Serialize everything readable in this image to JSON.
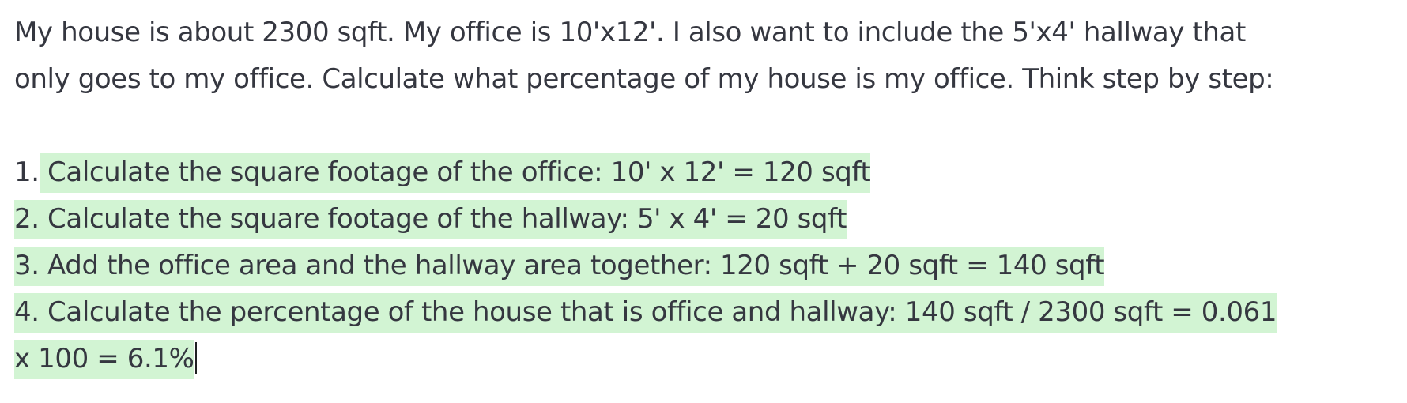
{
  "prompt": {
    "line1": "My house is about 2300 sqft. My office is 10'x12'. I also want to include the 5'x4' hallway that",
    "line2": "only goes to my office. Calculate what percentage of my house is my office. Think step by step:"
  },
  "completion": {
    "step1_number": "1.",
    "step1_text": " Calculate the square footage of the office: 10' x 12' = 120 sqft",
    "step2_text": "2. Calculate the square footage of the hallway: 5' x 4' = 20 sqft",
    "step3_text": "3. Add the office area and the hallway area together: 120 sqft + 20 sqft = 140 sqft",
    "step4_line1": "4. Calculate the percentage of the house that is office and hallway: 140 sqft / 2300 sqft = 0.061",
    "step4_line2": "x 100 = 6.1%"
  },
  "colors": {
    "highlight": "#d2f4d3",
    "text": "#353740"
  }
}
